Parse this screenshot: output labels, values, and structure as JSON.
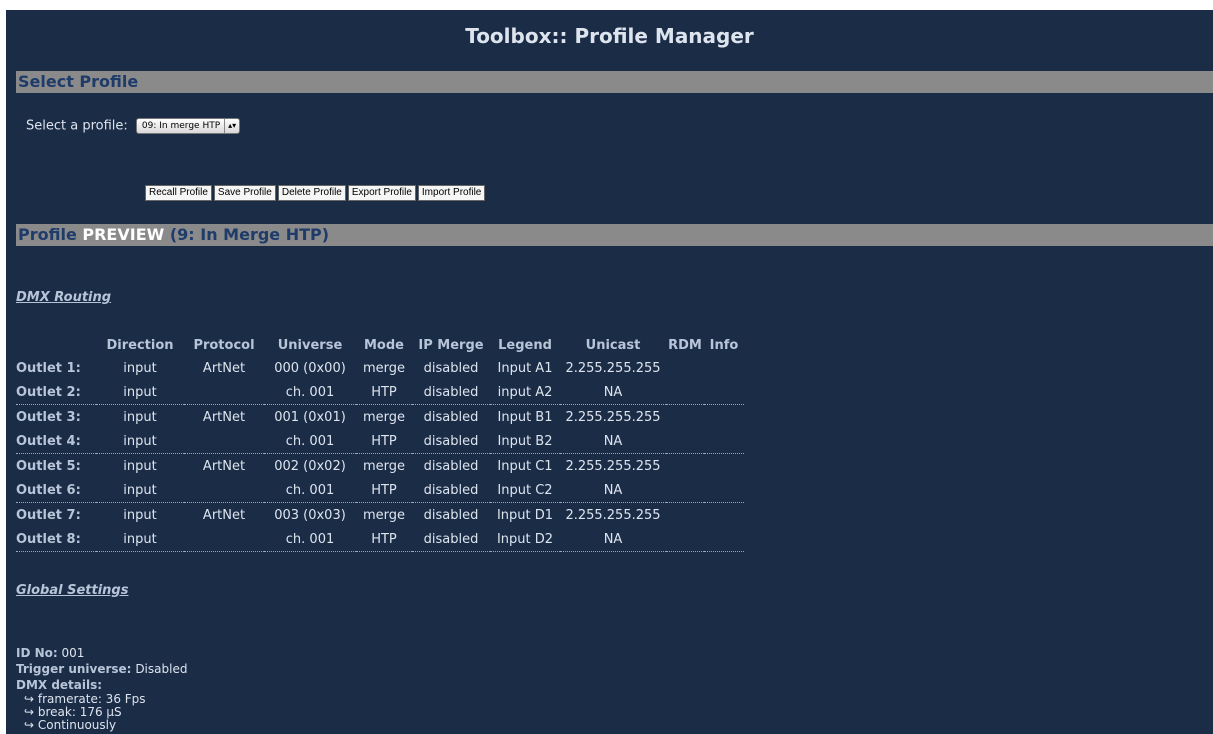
{
  "title": "Toolbox:: Profile Manager",
  "select_profile": {
    "heading": "Select Profile",
    "label": "Select a profile:",
    "selected": "09: In merge HTP",
    "buttons": [
      "Recall Profile",
      "Save Profile",
      "Delete Profile",
      "Export Profile",
      "Import Profile"
    ]
  },
  "preview": {
    "heading_prefix": "Profile ",
    "heading_highlight": "PREVIEW",
    "heading_suffix": " (9: In Merge HTP)"
  },
  "routing": {
    "heading": "DMX Routing",
    "columns": [
      "",
      "Direction",
      "Protocol",
      "Universe",
      "Mode",
      "IP Merge",
      "Legend",
      "Unicast",
      "RDM",
      "Info"
    ],
    "rows": [
      [
        "Outlet 1:",
        "input",
        "ArtNet",
        "000 (0x00)",
        "merge",
        "disabled",
        "Input A1",
        "2.255.255.255",
        "",
        ""
      ],
      [
        "Outlet 2:",
        "input",
        "",
        "ch. 001",
        "HTP",
        "disabled",
        "input A2",
        "NA",
        "",
        ""
      ],
      [
        "Outlet 3:",
        "input",
        "ArtNet",
        "001 (0x01)",
        "merge",
        "disabled",
        "Input B1",
        "2.255.255.255",
        "",
        ""
      ],
      [
        "Outlet 4:",
        "input",
        "",
        "ch. 001",
        "HTP",
        "disabled",
        "Input B2",
        "NA",
        "",
        ""
      ],
      [
        "Outlet 5:",
        "input",
        "ArtNet",
        "002 (0x02)",
        "merge",
        "disabled",
        "Input C1",
        "2.255.255.255",
        "",
        ""
      ],
      [
        "Outlet 6:",
        "input",
        "",
        "ch. 001",
        "HTP",
        "disabled",
        "Input C2",
        "NA",
        "",
        ""
      ],
      [
        "Outlet 7:",
        "input",
        "ArtNet",
        "003 (0x03)",
        "merge",
        "disabled",
        "Input D1",
        "2.255.255.255",
        "",
        ""
      ],
      [
        "Outlet 8:",
        "input",
        "",
        "ch. 001",
        "HTP",
        "disabled",
        "Input D2",
        "NA",
        "",
        ""
      ]
    ]
  },
  "global": {
    "heading": "Global Settings",
    "id_label": "ID No:",
    "id_value": "001",
    "trigger_label": "Trigger universe:",
    "trigger_value": "Disabled",
    "dmx_label": "DMX details:",
    "details": [
      "↪ framerate: 36 Fps",
      "↪ break: 176 µS",
      "↪ Continuously"
    ]
  },
  "colors": {
    "background": "#1b2c47",
    "section_bar": "#8a8a8a",
    "section_text": "#1e3b6a"
  }
}
